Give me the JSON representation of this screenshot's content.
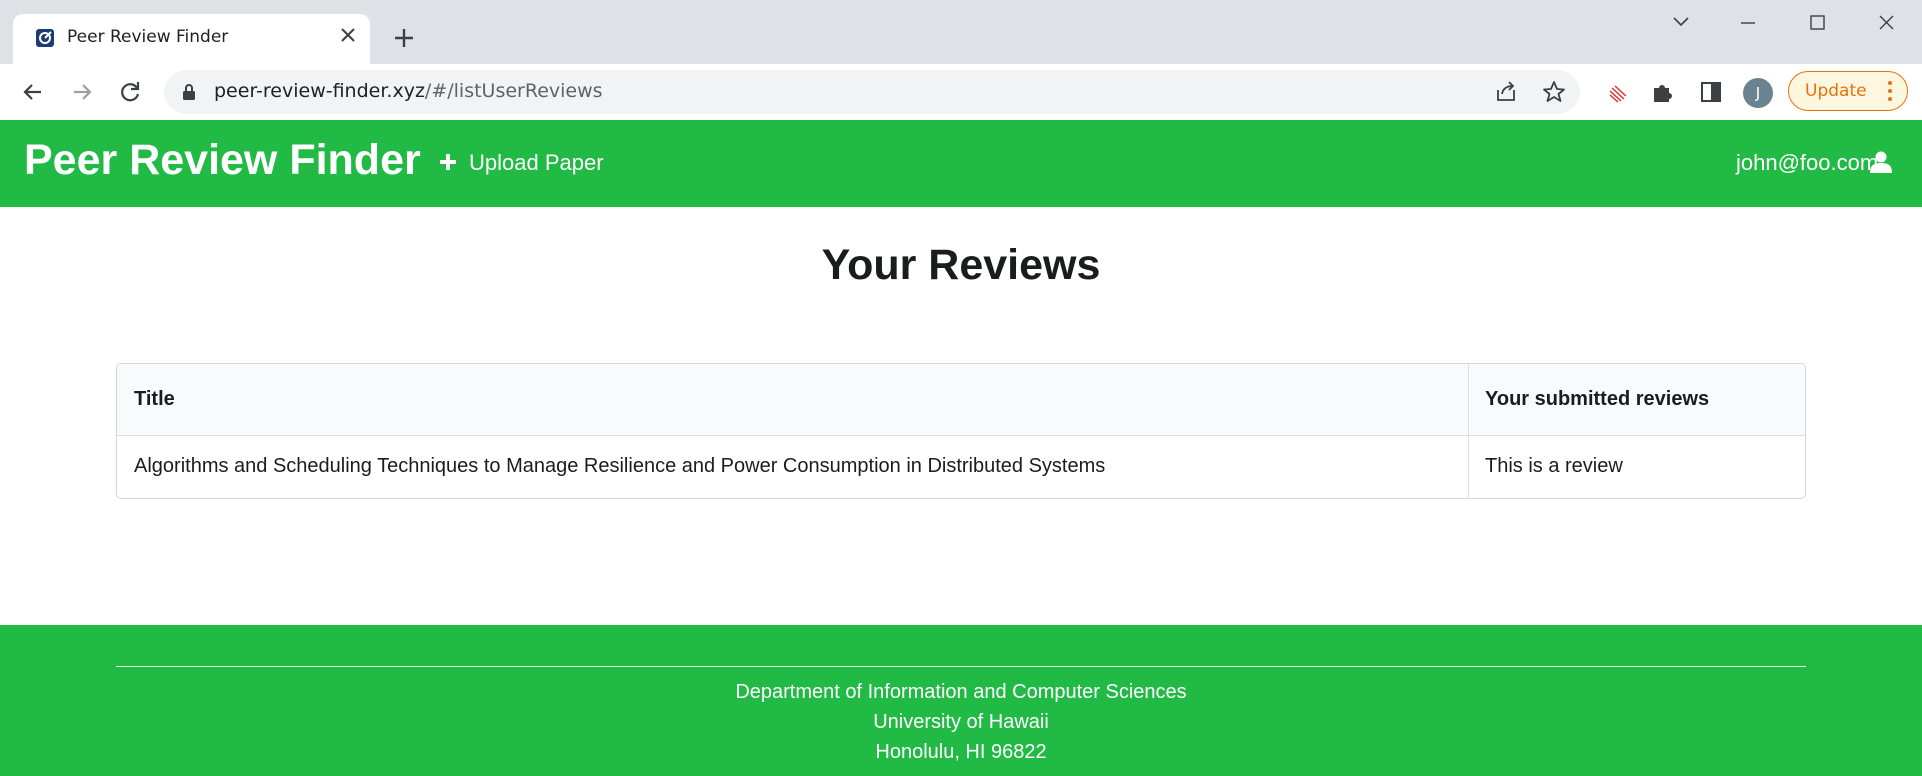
{
  "browser": {
    "tab_title": "Peer Review Finder",
    "url_host": "peer-review-finder.xyz",
    "url_path": "/#/listUserReviews",
    "profile_initial": "J",
    "update_label": "Update"
  },
  "navbar": {
    "brand": "Peer Review Finder",
    "upload_label": "Upload Paper",
    "user_email": "john@foo.com"
  },
  "main": {
    "title": "Your Reviews",
    "table": {
      "headers": [
        "Title",
        "Your submitted reviews"
      ],
      "rows": [
        [
          "Algorithms and Scheduling Techniques to Manage Resilience and Power Consumption in Distributed Systems",
          "This is a review"
        ]
      ]
    }
  },
  "footer": {
    "line1": "Department of Information and Computer Sciences",
    "line2": "University of Hawaii",
    "line3": "Honolulu, HI 96822"
  },
  "colors": {
    "brand_green": "#21ba45",
    "update_orange": "#e8710a"
  }
}
